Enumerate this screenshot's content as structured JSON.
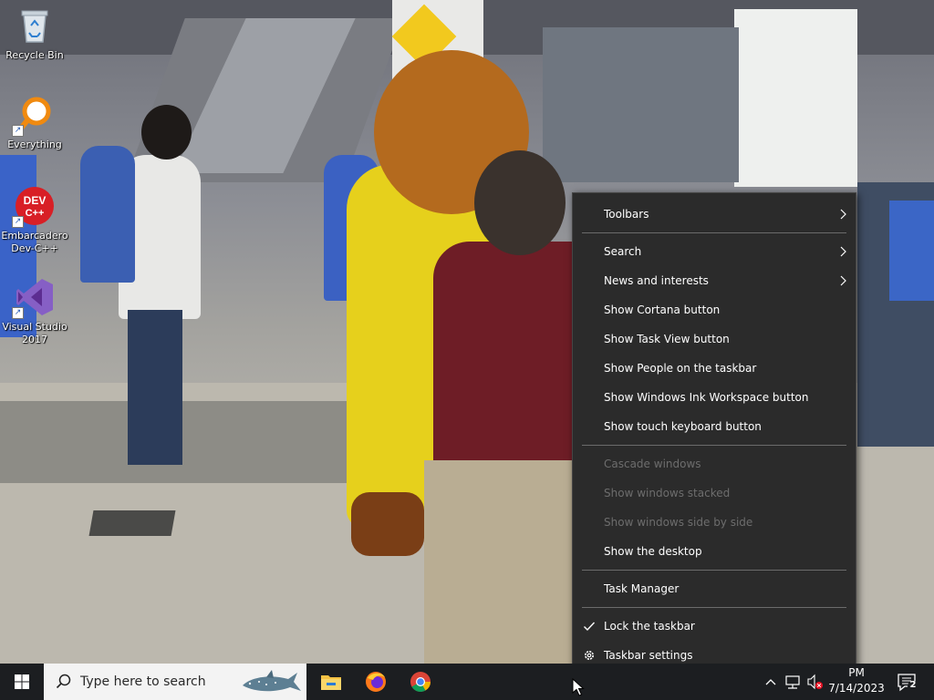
{
  "desktop": {
    "icons": [
      {
        "label": "Recycle Bin"
      },
      {
        "label": "Everything"
      },
      {
        "label": "Embarcadero\nDev-C++"
      },
      {
        "label": "Visual Studio\n2017"
      }
    ]
  },
  "context_menu": {
    "items": [
      {
        "label": "Toolbars",
        "has_submenu": true
      },
      {
        "label": "Search",
        "has_submenu": true
      },
      {
        "label": "News and interests",
        "has_submenu": true
      },
      {
        "label": "Show Cortana button"
      },
      {
        "label": "Show Task View button"
      },
      {
        "label": "Show People on the taskbar"
      },
      {
        "label": "Show Windows Ink Workspace button"
      },
      {
        "label": "Show touch keyboard button"
      },
      {
        "label": "Cascade windows",
        "disabled": true
      },
      {
        "label": "Show windows stacked",
        "disabled": true
      },
      {
        "label": "Show windows side by side",
        "disabled": true
      },
      {
        "label": "Show the desktop"
      },
      {
        "label": "Task Manager"
      },
      {
        "label": "Lock the taskbar",
        "checked": true
      },
      {
        "label": "Taskbar settings",
        "icon": "gear-icon"
      }
    ]
  },
  "taskbar": {
    "search_placeholder": "Type here to search",
    "pinned": [
      {
        "icon": "file-explorer-icon"
      },
      {
        "icon": "firefox-icon"
      },
      {
        "icon": "chrome-icon"
      }
    ],
    "clock": {
      "time": "PM",
      "date": "7/14/2023"
    },
    "notifications": {
      "count": "2"
    }
  },
  "colors": {
    "menu_bg": "#2b2b2b",
    "menu_text": "#ffffff",
    "menu_disabled": "#6d6d6d",
    "taskbar_bg": "#1c1e21",
    "search_bg": "#f3f3f3"
  }
}
